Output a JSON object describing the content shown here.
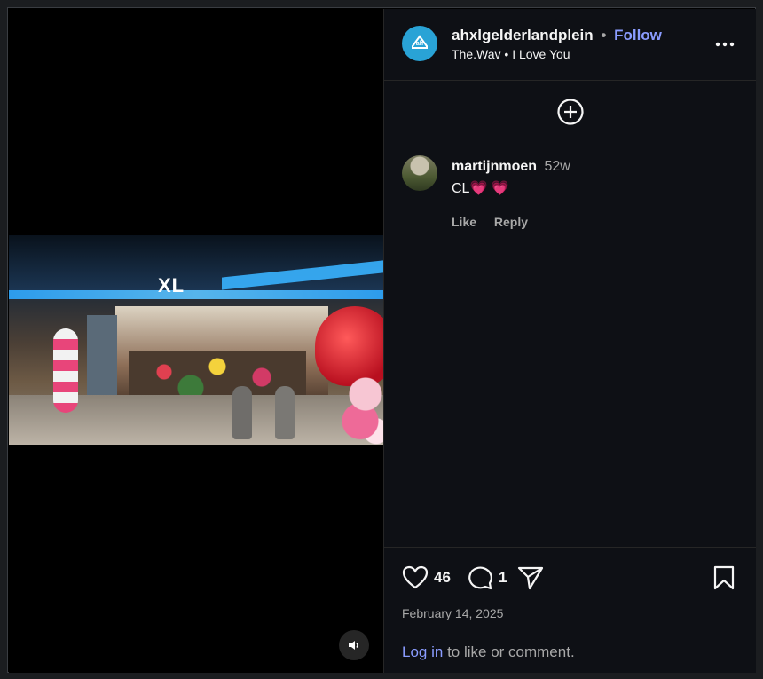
{
  "post": {
    "username": "ahxlgelderlandplein",
    "follow_label": "Follow",
    "audio_artist": "The.Wav",
    "audio_title": "I Love You",
    "video_sign": "XL",
    "likes": "46",
    "comments_count": "1",
    "date": "February 14, 2025"
  },
  "comments": [
    {
      "username": "martijnmoen",
      "time": "52w",
      "text": "CL💗 💗",
      "like_label": "Like",
      "reply_label": "Reply"
    }
  ],
  "footer": {
    "login_link": "Log in",
    "login_rest": "to like or comment."
  },
  "icons": {
    "more": "more-horizontal-icon",
    "add": "plus-circle-icon",
    "like": "heart-icon",
    "comment": "comment-bubble-icon",
    "share": "send-icon",
    "save": "bookmark-icon",
    "sound": "speaker-icon"
  }
}
